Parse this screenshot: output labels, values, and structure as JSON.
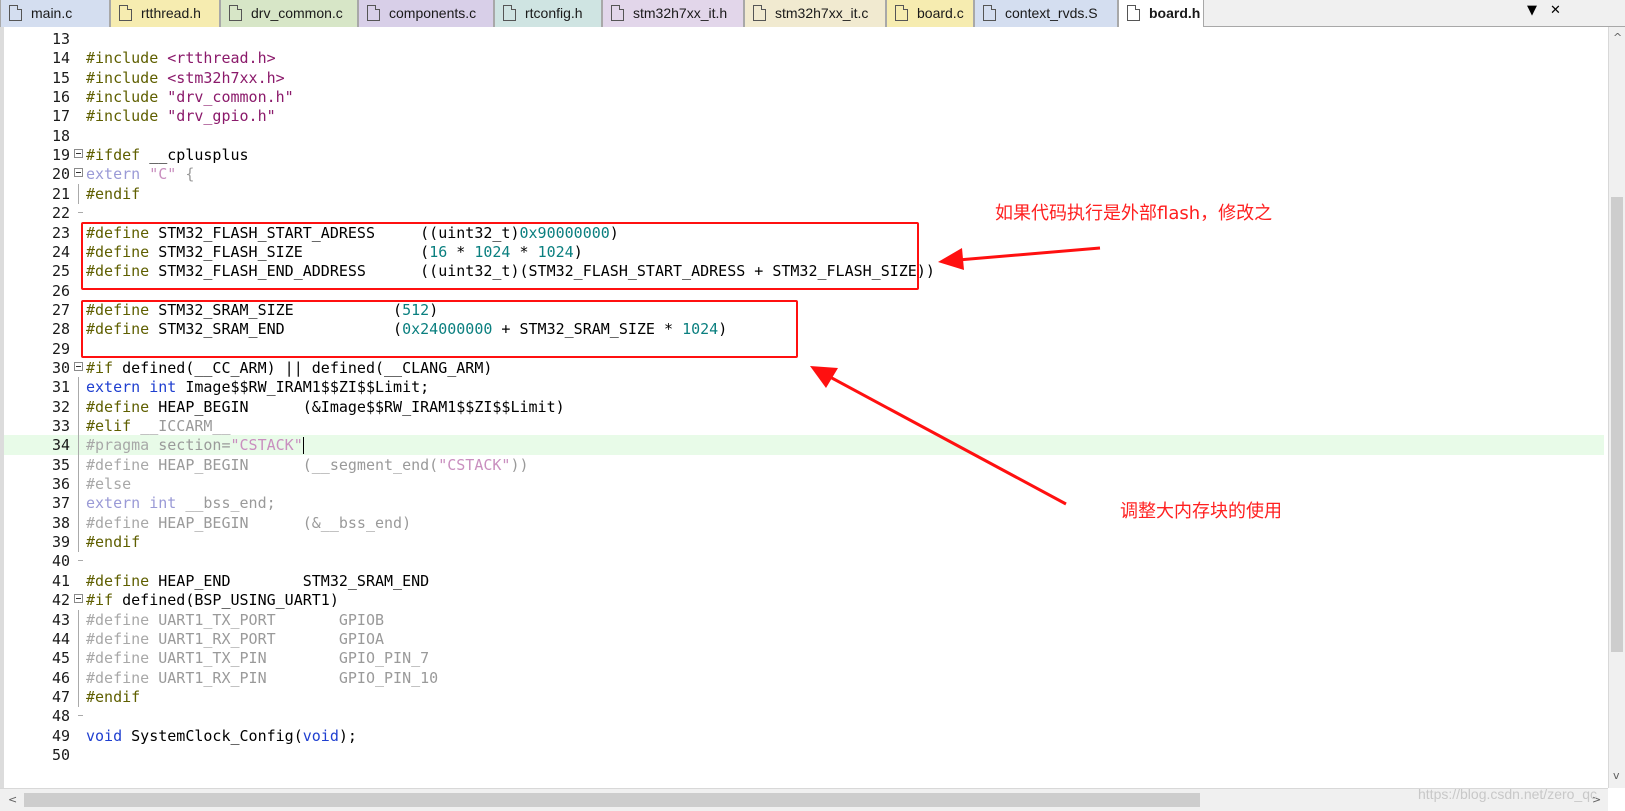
{
  "tabs": [
    {
      "label": "main.c",
      "color": "#d4def0"
    },
    {
      "label": "rtthread.h",
      "color": "#f6ecb0"
    },
    {
      "label": "drv_common.c",
      "color": "#d7e6c7"
    },
    {
      "label": "components.c",
      "color": "#d8cfe8"
    },
    {
      "label": "rtconfig.h",
      "color": "#cfe4e2"
    },
    {
      "label": "stm32h7xx_it.h",
      "color": "#e2d6ea"
    },
    {
      "label": "stm32h7xx_it.c",
      "color": "#f1ead0"
    },
    {
      "label": "board.c",
      "color": "#f6ecb0"
    },
    {
      "label": "context_rvds.S",
      "color": "#d4def0"
    },
    {
      "label": "board.h",
      "color": "#ffffff",
      "active": true
    }
  ],
  "tabbar": {
    "dropdown_icon": "▼",
    "close_icon": "✕"
  },
  "lines": [
    {
      "n": "13",
      "tokens": []
    },
    {
      "n": "14",
      "tokens": [
        [
          "pp",
          "#include "
        ],
        [
          "str",
          "<rtthread.h>"
        ]
      ]
    },
    {
      "n": "15",
      "tokens": [
        [
          "pp",
          "#include "
        ],
        [
          "str",
          "<stm32h7xx.h>"
        ]
      ]
    },
    {
      "n": "16",
      "tokens": [
        [
          "pp",
          "#include "
        ],
        [
          "str",
          "\"drv_common.h\""
        ]
      ]
    },
    {
      "n": "17",
      "tokens": [
        [
          "pp",
          "#include "
        ],
        [
          "str",
          "\"drv_gpio.h\""
        ]
      ]
    },
    {
      "n": "18",
      "tokens": []
    },
    {
      "n": "19",
      "fold": "start",
      "tokens": [
        [
          "pp",
          "#ifdef "
        ],
        [
          "",
          "__cplusplus"
        ]
      ]
    },
    {
      "n": "20",
      "fold": "start",
      "tokens": [
        [
          "kw-dim",
          "extern "
        ],
        [
          "str-dim",
          "\"C\""
        ],
        [
          "dim",
          " {"
        ]
      ]
    },
    {
      "n": "21",
      "fold": "mid",
      "tokens": [
        [
          "pp",
          "#endif"
        ]
      ]
    },
    {
      "n": "22",
      "fold": "end",
      "tokens": []
    },
    {
      "n": "23",
      "tokens": [
        [
          "pp",
          "#define "
        ],
        [
          "",
          "STM32_FLASH_START_ADRESS     ((uint32_t)"
        ],
        [
          "num",
          "0x90000000"
        ],
        [
          "",
          ")"
        ]
      ]
    },
    {
      "n": "24",
      "tokens": [
        [
          "pp",
          "#define "
        ],
        [
          "",
          "STM32_FLASH_SIZE             ("
        ],
        [
          "num",
          "16"
        ],
        [
          "",
          " * "
        ],
        [
          "num",
          "1024"
        ],
        [
          "",
          " * "
        ],
        [
          "num",
          "1024"
        ],
        [
          "",
          ")"
        ]
      ]
    },
    {
      "n": "25",
      "tokens": [
        [
          "pp",
          "#define "
        ],
        [
          "",
          "STM32_FLASH_END_ADDRESS      ((uint32_t)(STM32_FLASH_START_ADRESS + STM32_FLASH_SIZE))"
        ]
      ]
    },
    {
      "n": "26",
      "tokens": []
    },
    {
      "n": "27",
      "tokens": [
        [
          "pp",
          "#define "
        ],
        [
          "",
          "STM32_SRAM_SIZE           ("
        ],
        [
          "num",
          "512"
        ],
        [
          "",
          ")"
        ]
      ]
    },
    {
      "n": "28",
      "tokens": [
        [
          "pp",
          "#define "
        ],
        [
          "",
          "STM32_SRAM_END            ("
        ],
        [
          "num",
          "0x24000000"
        ],
        [
          "",
          " + STM32_SRAM_SIZE * "
        ],
        [
          "num",
          "1024"
        ],
        [
          "",
          ")"
        ]
      ]
    },
    {
      "n": "29",
      "tokens": []
    },
    {
      "n": "30",
      "fold": "start",
      "tokens": [
        [
          "pp",
          "#if "
        ],
        [
          "",
          "defined(__CC_ARM) || defined(__CLANG_ARM)"
        ]
      ]
    },
    {
      "n": "31",
      "fold": "mid",
      "tokens": [
        [
          "kw",
          "extern "
        ],
        [
          "kw",
          "int "
        ],
        [
          "",
          "Image$$RW_IRAM1$$ZI$$Limit;"
        ]
      ]
    },
    {
      "n": "32",
      "fold": "mid",
      "tokens": [
        [
          "pp",
          "#define "
        ],
        [
          "",
          "HEAP_BEGIN      (&Image$$RW_IRAM1$$ZI$$Limit)"
        ]
      ]
    },
    {
      "n": "33",
      "fold": "mid",
      "tokens": [
        [
          "pp",
          "#elif "
        ],
        [
          "dim",
          "__ICCARM__"
        ]
      ]
    },
    {
      "n": "34",
      "fold": "mid",
      "hl": true,
      "caret": true,
      "tokens": [
        [
          "pp-dim",
          "#pragma "
        ],
        [
          "dim",
          "section="
        ],
        [
          "str-dim",
          "\"CSTACK\""
        ]
      ]
    },
    {
      "n": "35",
      "fold": "mid",
      "tokens": [
        [
          "pp-dim",
          "#define "
        ],
        [
          "dim",
          "HEAP_BEGIN      (__segment_end("
        ],
        [
          "str-dim",
          "\"CSTACK\""
        ],
        [
          "dim",
          "))"
        ]
      ]
    },
    {
      "n": "36",
      "fold": "mid",
      "tokens": [
        [
          "pp-dim",
          "#else"
        ]
      ]
    },
    {
      "n": "37",
      "fold": "mid",
      "tokens": [
        [
          "kw-dim",
          "extern "
        ],
        [
          "kw-dim",
          "int "
        ],
        [
          "dim",
          "__bss_end;"
        ]
      ]
    },
    {
      "n": "38",
      "fold": "mid",
      "tokens": [
        [
          "pp-dim",
          "#define "
        ],
        [
          "dim",
          "HEAP_BEGIN      (&__bss_end)"
        ]
      ]
    },
    {
      "n": "39",
      "fold": "mid",
      "tokens": [
        [
          "pp",
          "#endif"
        ]
      ]
    },
    {
      "n": "40",
      "fold": "end",
      "tokens": []
    },
    {
      "n": "41",
      "tokens": [
        [
          "pp",
          "#define "
        ],
        [
          "",
          "HEAP_END        STM32_SRAM_END"
        ]
      ]
    },
    {
      "n": "42",
      "fold": "start",
      "tokens": [
        [
          "pp",
          "#if "
        ],
        [
          "",
          "defined(BSP_USING_UART1)"
        ]
      ]
    },
    {
      "n": "43",
      "fold": "mid",
      "tokens": [
        [
          "pp-dim",
          "#define "
        ],
        [
          "dim",
          "UART1_TX_PORT       GPIOB"
        ]
      ]
    },
    {
      "n": "44",
      "fold": "mid",
      "tokens": [
        [
          "pp-dim",
          "#define "
        ],
        [
          "dim",
          "UART1_RX_PORT       GPIOA"
        ]
      ]
    },
    {
      "n": "45",
      "fold": "mid",
      "tokens": [
        [
          "pp-dim",
          "#define "
        ],
        [
          "dim",
          "UART1_TX_PIN        GPIO_PIN_7"
        ]
      ]
    },
    {
      "n": "46",
      "fold": "mid",
      "tokens": [
        [
          "pp-dim",
          "#define "
        ],
        [
          "dim",
          "UART1_RX_PIN        GPIO_PIN_10"
        ]
      ]
    },
    {
      "n": "47",
      "fold": "mid",
      "tokens": [
        [
          "pp",
          "#endif"
        ]
      ]
    },
    {
      "n": "48",
      "fold": "end",
      "tokens": []
    },
    {
      "n": "49",
      "tokens": [
        [
          "kw",
          "void "
        ],
        [
          "",
          "SystemClock_Config("
        ],
        [
          "kw",
          "void"
        ],
        [
          "",
          ");"
        ]
      ]
    },
    {
      "n": "50",
      "tokens": []
    }
  ],
  "annotations": {
    "flash_note": "如果代码执行是外部flash，修改之",
    "sram_note": "调整大内存块的使用",
    "color": "#ff1010"
  },
  "watermark": "https://blog.csdn.net/zero_qc",
  "scroll": {
    "left_arrow": "<",
    "right_arrow": ">",
    "up_arrow": "^",
    "down_arrow": "v"
  }
}
